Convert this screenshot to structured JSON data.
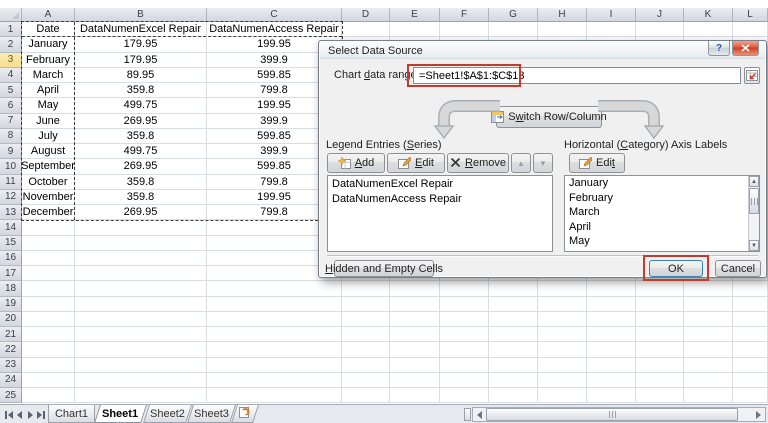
{
  "sheet": {
    "columns": [
      "A",
      "B",
      "C",
      "D",
      "E",
      "F",
      "G",
      "H",
      "I",
      "J",
      "K",
      "L"
    ],
    "visible_rows": 25,
    "highlighted_row": 3,
    "table": {
      "headers": [
        "Date",
        "DataNumenExcel Repair",
        "DataNumenAccess Repair"
      ],
      "rows": [
        [
          "January",
          "179.95",
          "199.95"
        ],
        [
          "February",
          "179.95",
          "399.9"
        ],
        [
          "March",
          "89.95",
          "599.85"
        ],
        [
          "April",
          "359.8",
          "799.8"
        ],
        [
          "May",
          "499.75",
          "199.95"
        ],
        [
          "June",
          "269.95",
          "399.9"
        ],
        [
          "July",
          "359.8",
          "599.85"
        ],
        [
          "August",
          "499.75",
          "399.9"
        ],
        [
          "September",
          "269.95",
          "599.85"
        ],
        [
          "October",
          "359.8",
          "799.8"
        ],
        [
          "November",
          "359.8",
          "199.95"
        ],
        [
          "December",
          "269.95",
          "799.8"
        ]
      ]
    }
  },
  "dialog": {
    "title": "Select Data Source",
    "help_glyph": "?",
    "range_label": "Chart data range:",
    "range_accel": 6,
    "range_value": "=Sheet1!$A$1:$C$13",
    "switch_label": "Switch Row/Column",
    "switch_accel": 1,
    "legend_label": "Legend Entries (Series)",
    "legend_accel": 16,
    "add_label": "Add",
    "add_accel": 0,
    "edit_label": "Edit",
    "edit_accel": 0,
    "remove_label": "Remove",
    "remove_accel": 0,
    "up_glyph": "▲",
    "down_glyph": "▼",
    "series": [
      "DataNumenExcel Repair",
      "DataNumenAccess Repair"
    ],
    "category_label": "Horizontal (Category) Axis Labels",
    "category_accel": 12,
    "category_edit_label": "Edit",
    "category_edit_accel": 3,
    "categories": [
      "January",
      "February",
      "March",
      "April",
      "May"
    ],
    "hidden_label": "Hidden and Empty Cells",
    "hidden_accel": 0,
    "ok_label": "OK",
    "cancel_label": "Cancel",
    "annotation_color": "#C23B2E"
  },
  "sheet_tabs": [
    {
      "label": "Chart1",
      "active": false
    },
    {
      "label": "Sheet1",
      "active": true
    },
    {
      "label": "Sheet2",
      "active": false
    },
    {
      "label": "Sheet3",
      "active": false
    }
  ]
}
